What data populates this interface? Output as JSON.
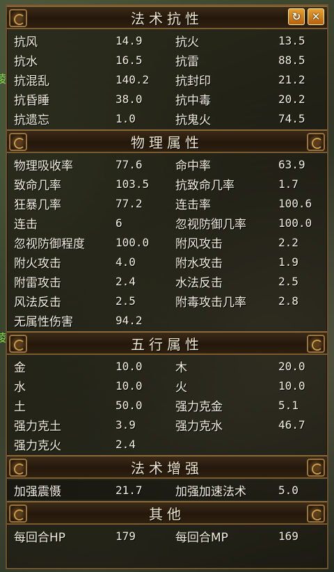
{
  "sections": [
    {
      "title": "法术抗性",
      "rows": [
        [
          "抗风",
          "14.9",
          "抗火",
          "13.5"
        ],
        [
          "抗水",
          "16.5",
          "抗雷",
          "88.5"
        ],
        [
          "抗混乱",
          "140.2",
          "抗封印",
          "21.2"
        ],
        [
          "抗昏睡",
          "38.0",
          "抗中毒",
          "20.2"
        ],
        [
          "抗遗忘",
          "1.0",
          "抗鬼火",
          "74.5"
        ]
      ]
    },
    {
      "title": "物理属性",
      "rows": [
        [
          "物理吸收率",
          "77.6",
          "命中率",
          "63.9"
        ],
        [
          "致命几率",
          "103.5",
          "抗致命几率",
          "1.7"
        ],
        [
          "狂暴几率",
          "77.2",
          "连击率",
          "100.6"
        ],
        [
          "连击",
          "6",
          "忽视防御几率",
          "100.0"
        ],
        [
          "忽视防御程度",
          "100.0",
          "附风攻击",
          "2.2"
        ],
        [
          "附火攻击",
          "4.0",
          "附水攻击",
          "1.9"
        ],
        [
          "附雷攻击",
          "2.4",
          "水法反击",
          "2.5"
        ],
        [
          "风法反击",
          "2.5",
          "附毒攻击几率",
          "2.8"
        ],
        [
          "无属性伤害",
          "94.2",
          "",
          ""
        ]
      ]
    },
    {
      "title": "五行属性",
      "rows": [
        [
          "金",
          "10.0",
          "木",
          "20.0"
        ],
        [
          "水",
          "10.0",
          "火",
          "10.0"
        ],
        [
          "土",
          "50.0",
          "强力克金",
          "5.1"
        ],
        [
          "强力克土",
          "3.9",
          "强力克水",
          "46.7"
        ],
        [
          "强力克火",
          "2.4",
          "",
          ""
        ]
      ]
    },
    {
      "title": "法术增强",
      "rows": [
        [
          "加强震慑",
          "21.7",
          "加强加速法术",
          "5.0"
        ]
      ]
    },
    {
      "title": "其他",
      "rows": [
        [
          "每回合HP",
          "179",
          "每回合MP",
          "169"
        ]
      ]
    }
  ],
  "controls": {
    "refresh_icon": "refresh-icon",
    "close_icon": "close-icon",
    "refresh_glyph": "↻",
    "close_glyph": "✕"
  },
  "side_glyphs": [
    "凌",
    "凌"
  ]
}
